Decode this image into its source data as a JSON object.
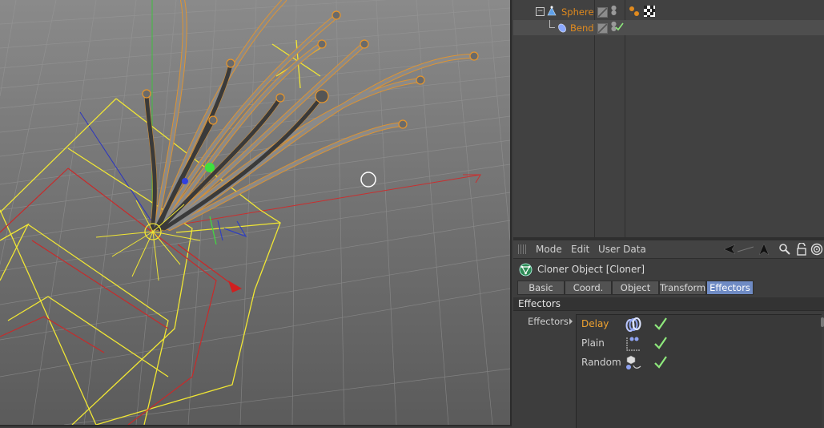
{
  "object_manager": {
    "rows": [
      {
        "name": "Sphere",
        "selected": false
      },
      {
        "name": "Bend",
        "selected": true
      }
    ]
  },
  "attribute_manager": {
    "menu": [
      "Mode",
      "Edit",
      "User Data"
    ],
    "object_title": "Cloner Object [Cloner]",
    "tabs": [
      {
        "label": "Basic",
        "active": false
      },
      {
        "label": "Coord.",
        "active": false
      },
      {
        "label": "Object",
        "active": false
      },
      {
        "label": "Transform",
        "active": false
      },
      {
        "label": "Effectors",
        "active": true
      }
    ],
    "section_title": "Effectors",
    "field_label": "Effectors",
    "effectors": [
      {
        "name": "Delay",
        "highlighted": true,
        "icon": "delay-effector-icon",
        "enabled": true
      },
      {
        "name": "Plain",
        "highlighted": false,
        "icon": "plain-effector-icon",
        "enabled": true
      },
      {
        "name": "Random",
        "highlighted": false,
        "icon": "random-effector-icon",
        "enabled": true
      }
    ]
  },
  "colors": {
    "selection_orange": "#e08a1e",
    "active_tab": "#6f8bc4",
    "check_green": "#8ee87c",
    "wire_yellow": "#f0e634"
  }
}
